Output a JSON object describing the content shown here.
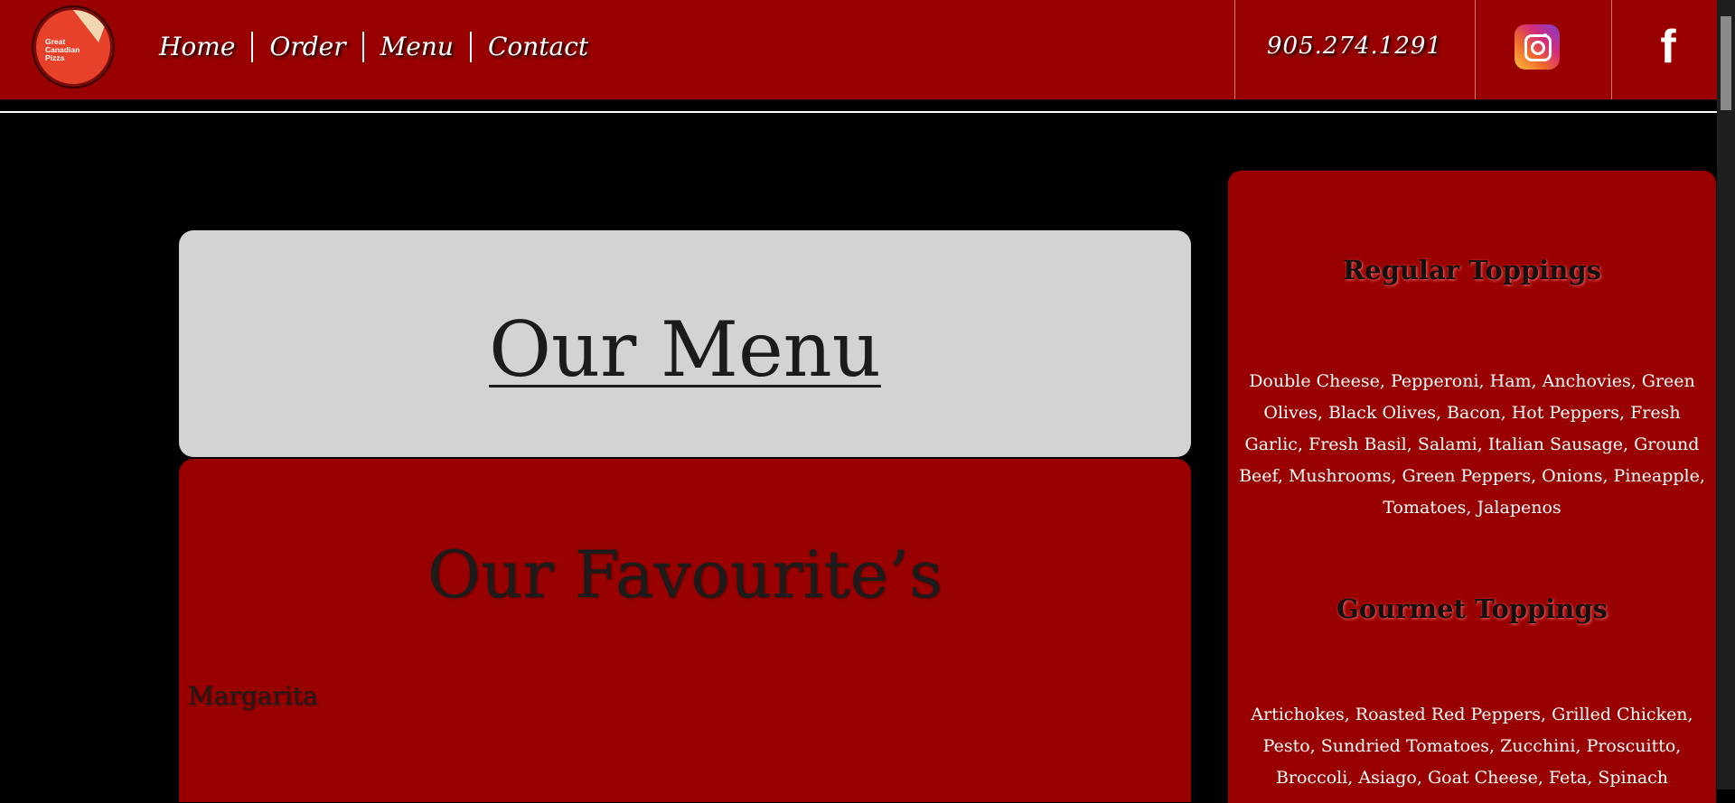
{
  "header": {
    "logo_text": "Great Canadian Pizza",
    "nav": [
      {
        "label": "Home"
      },
      {
        "label": "Order"
      },
      {
        "label": "Menu"
      },
      {
        "label": "Contact"
      }
    ],
    "phone": "905.274.1291",
    "icons": [
      "instagram-icon",
      "facebook-icon"
    ],
    "facebook_glyph": "f"
  },
  "main": {
    "menu_title": "Our Menu",
    "favourites_title": "Our Favourite’s",
    "favourites": [
      "Margarita"
    ]
  },
  "sidebar": {
    "regular_heading": "Regular Toppings",
    "regular_text": "Double Cheese, Pepperoni, Ham, Anchovies, Green Olives, Black Olives, Bacon, Hot Peppers, Fresh Garlic, Fresh Basil, Salami, Italian Sausage, Ground Beef, Mushrooms, Green Peppers, Onions, Pineapple, Tomatoes, Jalapenos",
    "gourmet_heading": "Gourmet Toppings",
    "gourmet_text": "Artichokes, Roasted Red Peppers, Grilled Chicken, Pesto, Sundried Tomatoes, Zucchini, Proscuitto, Broccoli, Asiago, Goat Cheese, Feta, Spinach"
  },
  "colors": {
    "brand_red": "#990000",
    "title_box": "#d3d3d3",
    "background": "#000000"
  }
}
